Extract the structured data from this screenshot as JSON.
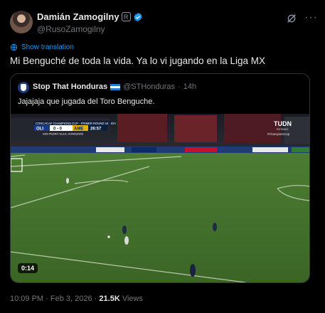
{
  "author": {
    "name": "Damián Zamogilny",
    "badge": "R",
    "handle": "@RusoZamogilny"
  },
  "show_translation": "Show translation",
  "tweet_text": "Mi Benguché de toda la vida. Ya lo vi jugando en la Liga MX",
  "quote": {
    "name": "Stop That Honduras",
    "handle": "@STHonduras",
    "separator": "·",
    "time": "14h",
    "text": "Jajajaja que jugada del Toro Benguche."
  },
  "scoreboard": {
    "competition": "CONCACAF CHAMPIONS CUP · PRIMER ROUND 16 · IDA",
    "home": "OLI",
    "score": "0 - 0",
    "away": "AME",
    "clock": "26:57",
    "venue": "SAN PEDRO SULA, HONDURAS"
  },
  "broadcaster": {
    "logo": "TUDN",
    "sub": "ESTADIO",
    "tag": "#ChampionsCup"
  },
  "video_duration": "0:14",
  "meta": {
    "time": "10:09 PM",
    "date": "Feb 3, 2026",
    "views_count": "21.5K",
    "views_label": "Views"
  },
  "colors": {
    "accent": "#1d9bf0",
    "pitch": "#3f6b2a",
    "background": "#000000"
  },
  "icons": {
    "verified": "verified-badge-icon",
    "grok": "grok-icon",
    "more": "more-icon",
    "translate": "globe-icon"
  }
}
